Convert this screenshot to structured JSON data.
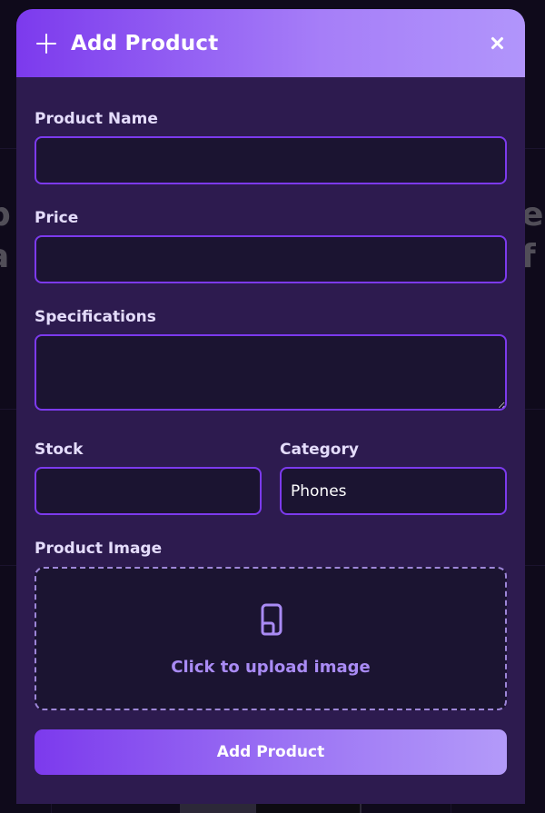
{
  "modal": {
    "title": "Add Product",
    "fields": {
      "product_name": {
        "label": "Product Name",
        "value": ""
      },
      "price": {
        "label": "Price",
        "value": ""
      },
      "specifications": {
        "label": "Specifications",
        "value": ""
      },
      "stock": {
        "label": "Stock",
        "value": ""
      },
      "category": {
        "label": "Category",
        "value": "Phones"
      },
      "product_image": {
        "label": "Product Image",
        "upload_text": "Click to upload image"
      }
    },
    "submit_label": "Add Product"
  },
  "colors": {
    "accent": "#7c3aed",
    "modal_bg": "#2d1b4f",
    "input_bg": "#1b1431",
    "header_gradient_end": "#b195fb",
    "upload_text": "#a98bf4"
  },
  "icons": {
    "header": "plus-icon",
    "close": "close-icon",
    "upload": "phone-icon"
  }
}
